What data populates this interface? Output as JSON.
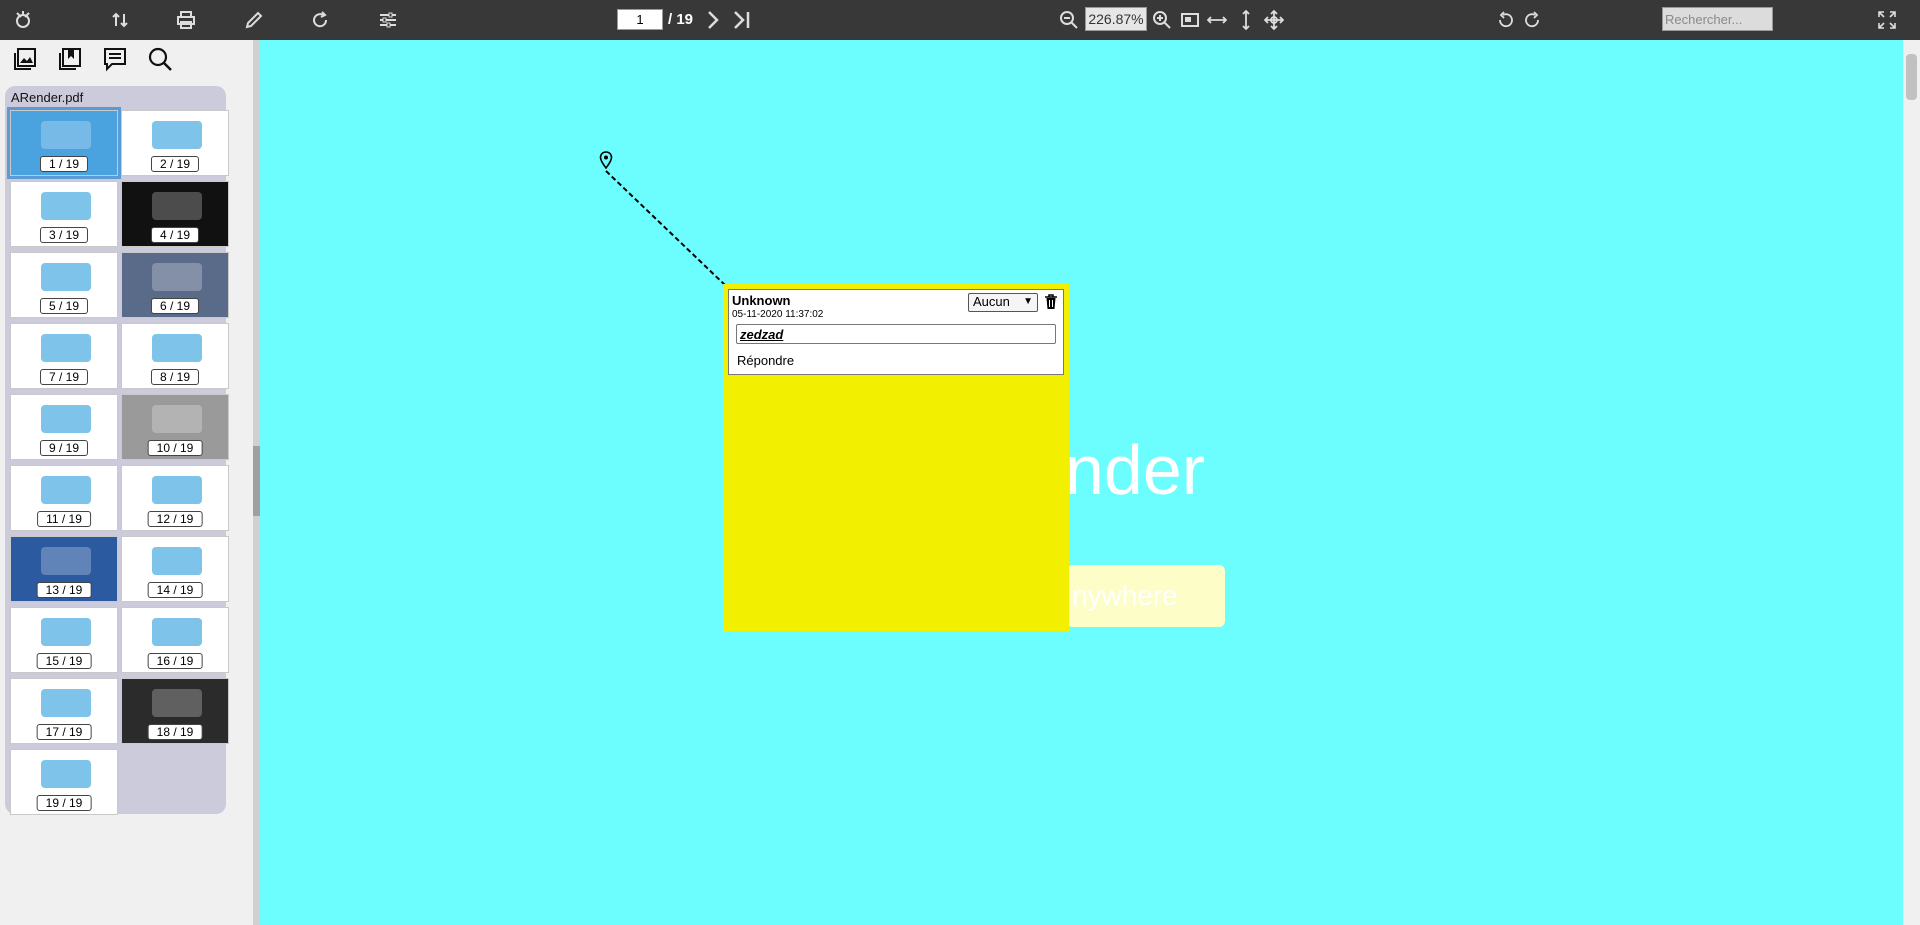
{
  "toolbar": {
    "page_current": "1",
    "page_total": "/ 19",
    "zoom": "226.87%",
    "search_placeholder": "Rechercher..."
  },
  "sidebar": {
    "doc_name": "ARender.pdf",
    "thumbnails": [
      {
        "label": "1 / 19"
      },
      {
        "label": "2 / 19"
      },
      {
        "label": "3 / 19"
      },
      {
        "label": "4 / 19"
      },
      {
        "label": "5 / 19"
      },
      {
        "label": "6 / 19"
      },
      {
        "label": "7 / 19"
      },
      {
        "label": "8 / 19"
      },
      {
        "label": "9 / 19"
      },
      {
        "label": "10 / 19"
      },
      {
        "label": "11 / 19"
      },
      {
        "label": "12 / 19"
      },
      {
        "label": "13 / 19"
      },
      {
        "label": "14 / 19"
      },
      {
        "label": "15 / 19"
      },
      {
        "label": "16 / 19"
      },
      {
        "label": "17 / 19"
      },
      {
        "label": "18 / 19"
      },
      {
        "label": "19 / 19"
      }
    ]
  },
  "document": {
    "title_fragment": "nder",
    "pill_fragment": "nywhere"
  },
  "comment": {
    "author": "Unknown",
    "date": "05-11-2020 11:37:02",
    "status": "Aucun",
    "text": "zedzad",
    "reply_label": "Répondre"
  },
  "colors": {
    "toolbar_bg": "#383838",
    "viewer_bg": "#6cfefe",
    "note_bg": "#f2f000",
    "active_thumb": "#4aa3df"
  }
}
